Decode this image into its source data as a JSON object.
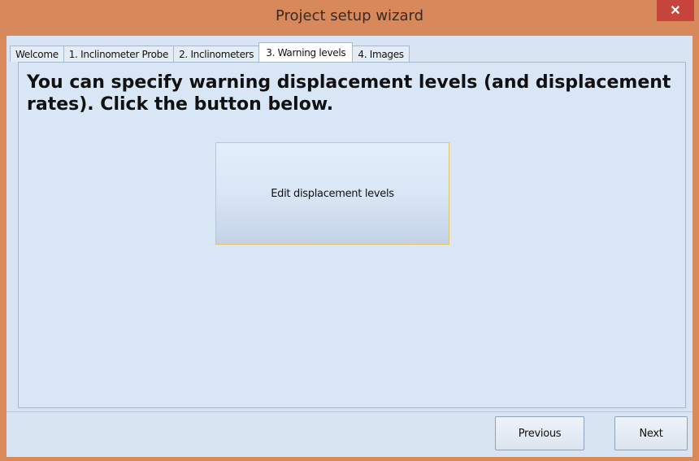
{
  "window": {
    "title": "Project setup wizard",
    "close_glyph": "✕"
  },
  "tabs": [
    {
      "label": "Welcome",
      "active": false
    },
    {
      "label": "1. Inclinometer Probe",
      "active": false
    },
    {
      "label": "2. Inclinometers",
      "active": false
    },
    {
      "label": "3. Warning levels",
      "active": true
    },
    {
      "label": "4. Images",
      "active": false
    }
  ],
  "content": {
    "heading": "You can specify warning displacement levels (and displacement rates). Click the button below.",
    "edit_button_label": "Edit displacement levels"
  },
  "footer": {
    "previous_label": "Previous",
    "next_label": "Next"
  },
  "colors": {
    "titlebar": "#d7895b",
    "close_button": "#c7443d",
    "client_background": "#d8e4f2",
    "edit_button_border": "#e5c565"
  }
}
